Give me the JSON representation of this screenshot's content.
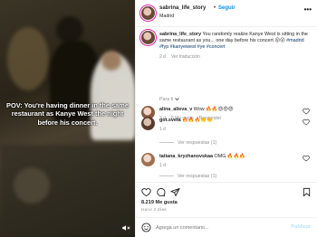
{
  "media": {
    "overlay_text": "POV: You're having dinner in the same restaurant as Kanye West the night before his concert.",
    "mute_icon": "speaker-muted-icon"
  },
  "header": {
    "username": "sabrina_life_story",
    "dot": "•",
    "follow_label": "Seguir",
    "location": "Madrid",
    "more_icon": "•••"
  },
  "caption": {
    "username": "sabrina_life_story",
    "text": " You randomly realize Kanye West is sitting in the same restaurant as you... one day before his concert 😮😮",
    "tags": " #madrid #fyp #kanyewest #ye #concert",
    "time": "2 d",
    "translate_label": "Ver traducción"
  },
  "section_label": "Para ti",
  "comments": [
    {
      "username": "alina_alieva_v",
      "text": " Wow 🔥🔥😍😍😍",
      "time": "3 d",
      "likes": "8 Me gusta",
      "reply": "Responder"
    },
    {
      "username": "got.sveta",
      "text": " 🔥🔥🔥👏👏",
      "time": "1 d",
      "replies": "Ver respuestas (1)"
    },
    {
      "username": "tatiana_kryzhanovskaa",
      "text": " OMG 🔥🔥🔥",
      "time": "1 d",
      "replies": "Ver respuestas (1)"
    }
  ],
  "stats": {
    "likes": "8.219 Me gusta",
    "ago": "Hace 2 días"
  },
  "add_comment": {
    "placeholder": "Agrega un comentario...",
    "post_label": "Publicar"
  },
  "colors": {
    "link": "#0095f6",
    "hashtag": "#00376b",
    "muted": "#8e8e8e",
    "post_disabled": "#b2dffc"
  }
}
